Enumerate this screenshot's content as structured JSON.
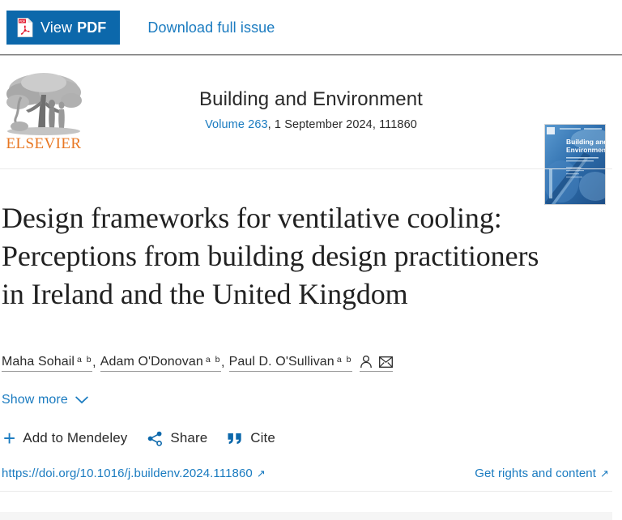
{
  "topbar": {
    "view_pdf_label_light": "View",
    "view_pdf_label_bold": "PDF",
    "pdf_icon_name": "pdf-file-icon",
    "download_issue_label": "Download full issue"
  },
  "banner": {
    "publisher_logo_name": "elsevier-logo",
    "publisher_wordmark": "ELSEVIER",
    "journal_title": "Building and Environment",
    "volume_link_label": "Volume 263",
    "issue_meta": ", 1 September 2024, 111860",
    "cover_title_line1": "Building and",
    "cover_title_line2": "Environment",
    "cover_alt": "journal-cover-image"
  },
  "article": {
    "title": "Design frameworks for ventilative cooling: Perceptions from building design practitioners in Ireland and the United Kingdom",
    "authors": [
      {
        "name": "Maha Sohail",
        "affiliations": "a b"
      },
      {
        "name": "Adam O'Donovan",
        "affiliations": "a b"
      },
      {
        "name": "Paul D. O'Sullivan",
        "affiliations": "a b"
      }
    ],
    "author_separator": ",",
    "author_icons": [
      "author-profile-icon",
      "email-author-icon"
    ],
    "show_more_label": "Show more",
    "show_more_icon": "chevron-down-icon"
  },
  "actions": [
    {
      "label": "Add to Mendeley",
      "icon": "plus-icon"
    },
    {
      "label": "Share",
      "icon": "share-nodes-icon"
    },
    {
      "label": "Cite",
      "icon": "quote-icon"
    }
  ],
  "doi": {
    "url_label": "https://doi.org/10.1016/j.buildenv.2024.111860",
    "external_icon": "↗",
    "rights_label": "Get rights and content",
    "rights_external_icon": "↗"
  },
  "colors": {
    "primary_blue": "#0c68ab",
    "link_blue": "#1a7bc0",
    "elsevier_orange": "#e87722",
    "pdf_red": "#e1142a",
    "text_dark": "#2a2a2a"
  }
}
